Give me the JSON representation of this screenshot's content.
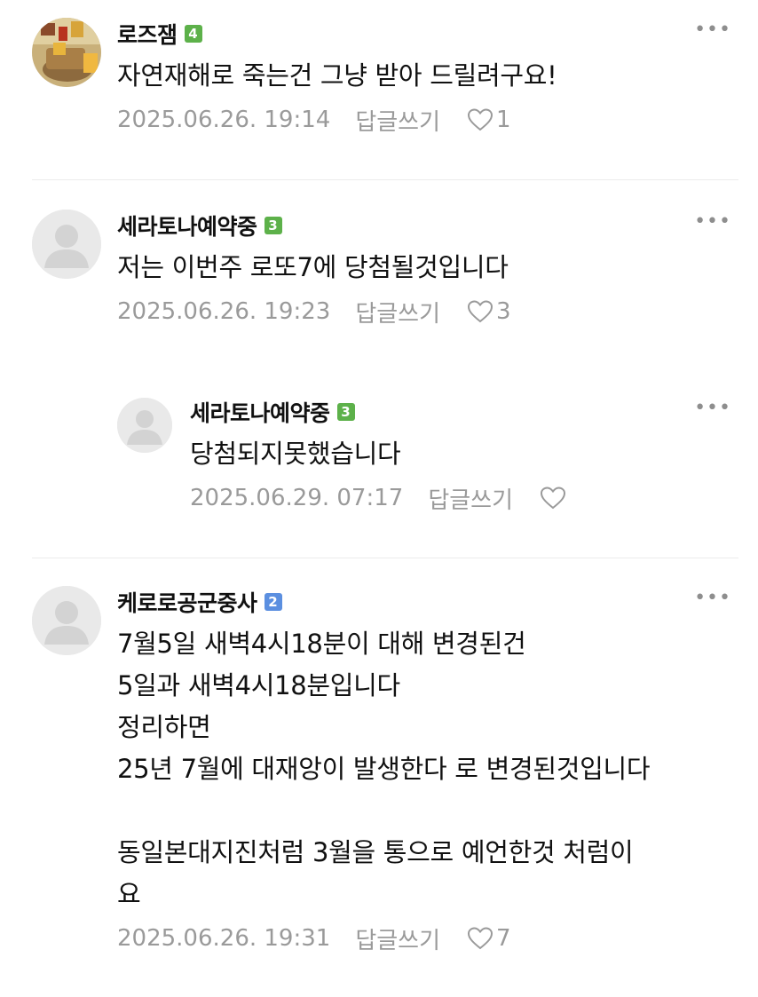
{
  "comments": [
    {
      "nickname": "로즈잼",
      "level": "4",
      "level_color": "#5db14a",
      "text": "자연재해로 죽는건 그냥 받아 드릴려구요!",
      "date": "2025.06.26. 19:14",
      "reply_label": "답글쓰기",
      "likes": "1",
      "more": "•••"
    },
    {
      "nickname": "세라토나예약중",
      "level": "3",
      "level_color": "#5db14a",
      "text": "저는 이번주 로또7에 당첨될것입니다",
      "date": "2025.06.26. 19:23",
      "reply_label": "답글쓰기",
      "likes": "3",
      "more": "•••"
    },
    {
      "nickname": "세라토나예약중",
      "level": "3",
      "level_color": "#5db14a",
      "text": "당첨되지못했습니다",
      "date": "2025.06.29. 07:17",
      "reply_label": "답글쓰기",
      "likes": "",
      "more": "•••"
    },
    {
      "nickname": "케로로공군중사",
      "level": "2",
      "level_color": "#5b8fe0",
      "text": "7월5일 새벽4시18분이 대해 변경된건\n5일과 새벽4시18분입니다\n정리하면\n25년 7월에 대재앙이 발생한다 로 변경된것입니다\n\n동일본대지진처럼 3월을 통으로 예언한것 처럼이\n요",
      "date": "2025.06.26. 19:31",
      "reply_label": "답글쓰기",
      "likes": "7",
      "more": "•••"
    }
  ],
  "colors": {
    "text": "#111111",
    "meta": "#9a9a9a",
    "divider": "#ececec",
    "level_green": "#5db14a",
    "level_blue": "#5b8fe0"
  }
}
